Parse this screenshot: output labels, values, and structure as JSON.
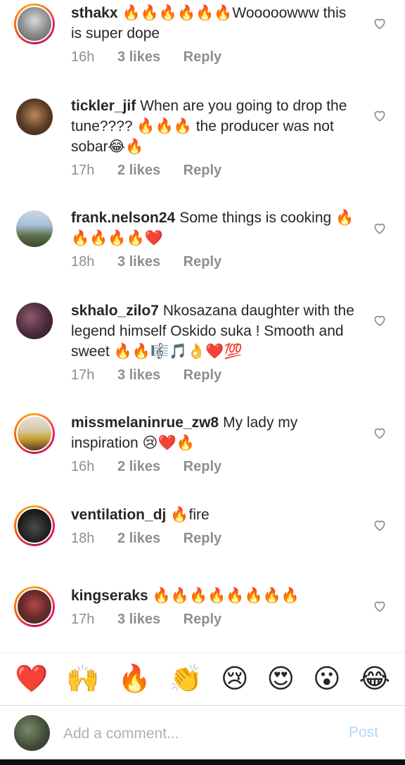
{
  "comments": [
    {
      "username": "sthakx",
      "text": "🔥🔥🔥🔥🔥🔥Wooooowww this is super dope",
      "time": "16h",
      "likes": "3 likes",
      "reply": "Reply"
    },
    {
      "username": "tickler_jif",
      "text": "When are you  going to  drop the tune???? 🔥🔥🔥 the producer was not sobar😂🔥",
      "time": "17h",
      "likes": "2 likes",
      "reply": "Reply"
    },
    {
      "username": "frank.nelson24",
      "text": "Some things is cooking 🔥🔥🔥🔥🔥❤️",
      "time": "18h",
      "likes": "3 likes",
      "reply": "Reply"
    },
    {
      "username": "skhalo_zilo7",
      "text": "Nkosazana daughter with the legend himself Oskido suka ! Smooth and sweet 🔥🔥🎼🎵👌❤️💯",
      "time": "17h",
      "likes": "3 likes",
      "reply": "Reply"
    },
    {
      "username": "missmelaninrue_zw8",
      "text": "My lady my inspiration 😢❤️🔥",
      "time": "16h",
      "likes": "2 likes",
      "reply": "Reply"
    },
    {
      "username": "ventilation_dj",
      "text": "🔥fire",
      "time": "18h",
      "likes": "2 likes",
      "reply": "Reply"
    },
    {
      "username": "kingseraks",
      "text": "🔥🔥🔥🔥🔥🔥🔥🔥",
      "time": "17h",
      "likes": "3 likes",
      "reply": "Reply"
    }
  ],
  "reactions": [
    "❤️",
    "🙌",
    "🔥",
    "👏",
    "😢",
    "😍",
    "😮",
    "😂"
  ],
  "composer": {
    "placeholder": "Add a comment...",
    "post_label": "Post"
  },
  "icons": {
    "like": "heart-outline-icon"
  },
  "colors": {
    "username": "#262626",
    "meta": "#8e8e8e",
    "post": "#b3d8fb"
  }
}
